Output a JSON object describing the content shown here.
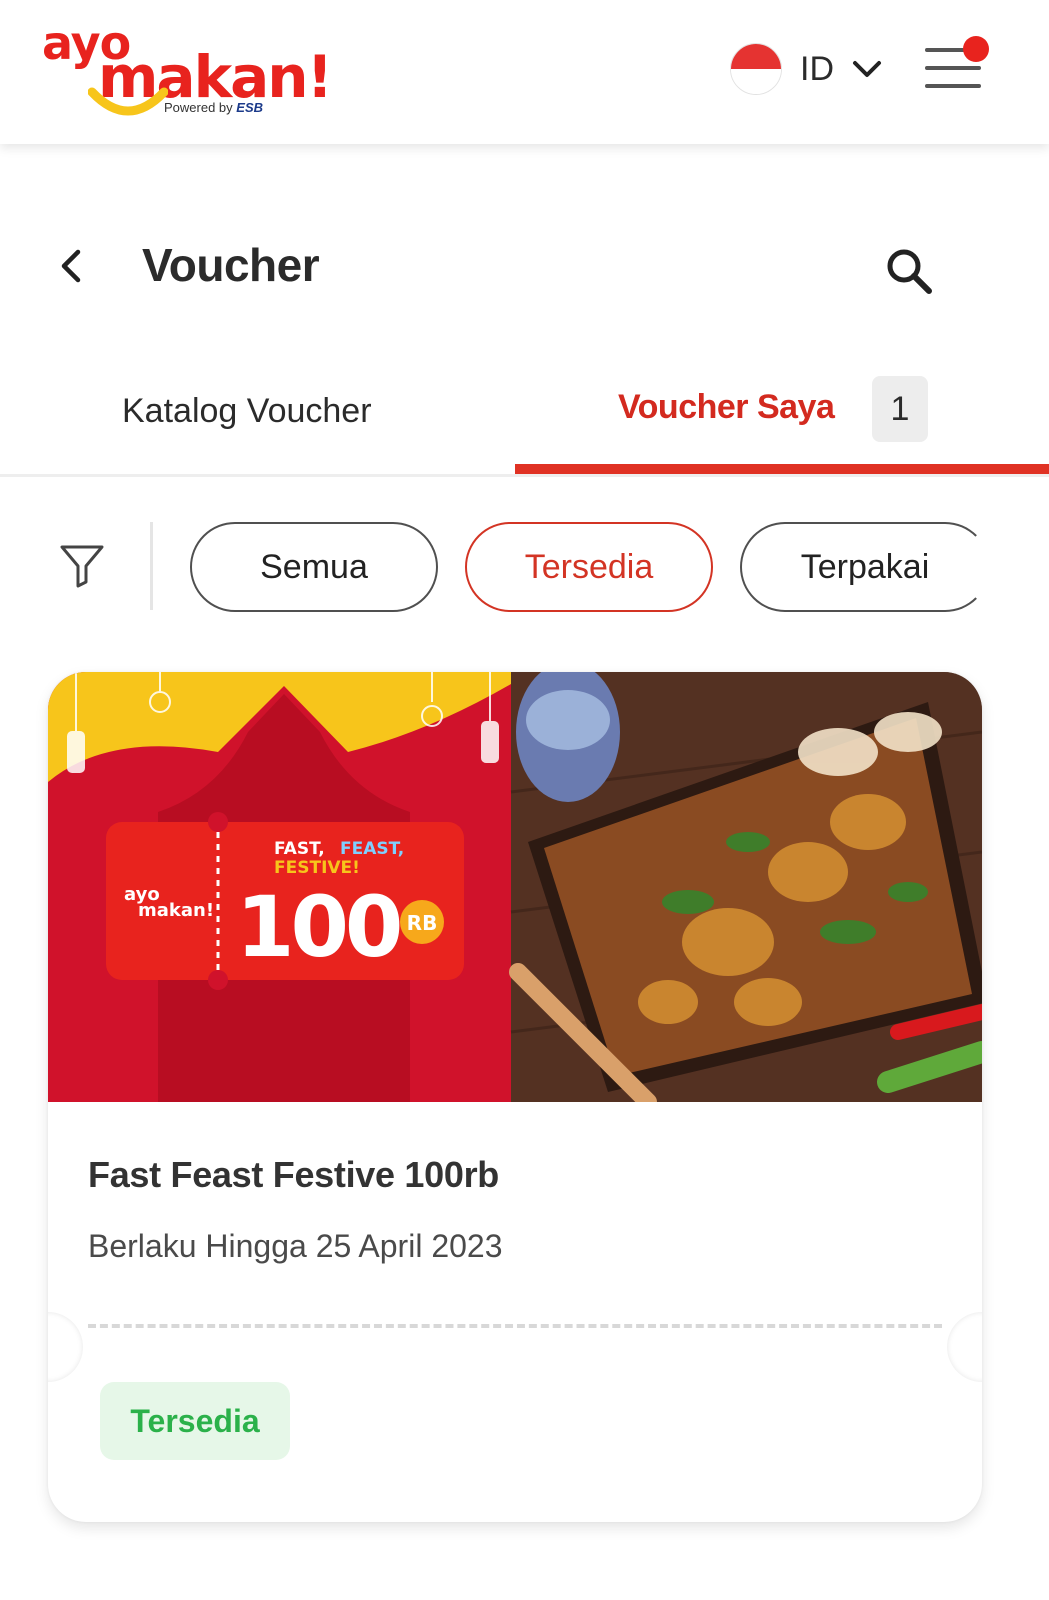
{
  "header": {
    "logo": {
      "word1": "ayo",
      "word2": "makan!",
      "powered_by": "Powered by",
      "partner": "ESB"
    },
    "language": {
      "code": "ID",
      "flag": "indonesia-flag"
    },
    "menu_icon": "hamburger-icon",
    "notification_dot": true
  },
  "page": {
    "title": "Voucher",
    "back_icon": "chevron-left-icon",
    "search_icon": "search-icon"
  },
  "tabs": [
    {
      "label": "Katalog Voucher",
      "active": false
    },
    {
      "label": "Voucher Saya",
      "active": true,
      "count": "1"
    }
  ],
  "filters": {
    "icon": "filter-icon",
    "chips": [
      {
        "label": "Semua",
        "active": false
      },
      {
        "label": "Tersedia",
        "active": true
      },
      {
        "label": "Terpakai",
        "active": false
      }
    ]
  },
  "voucher": {
    "banner": {
      "brand_top": "ayo",
      "brand_bottom": "makan!",
      "headline_1": "FAST,",
      "headline_2": "FEAST,",
      "headline_3": "FESTIVE!",
      "amount": "100",
      "unit": "RB"
    },
    "title": "Fast Feast Festive 100rb",
    "validity": "Berlaku Hingga 25 April 2023",
    "status": "Tersedia"
  },
  "colors": {
    "accent": "#e03224",
    "status_green": "#2bb14a",
    "status_green_bg": "#e6f7e8",
    "banner_red": "#d0122b",
    "banner_yellow": "#f7c51b"
  }
}
